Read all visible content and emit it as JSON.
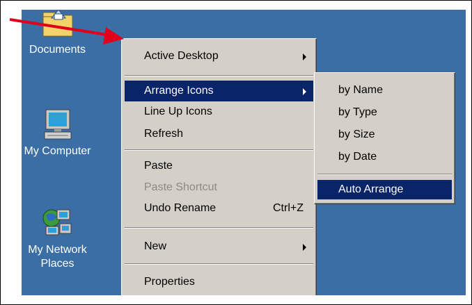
{
  "desktop": {
    "icons": [
      {
        "label": "Documents",
        "icon": "folder-icon"
      },
      {
        "label": "My Computer",
        "icon": "computer-icon"
      },
      {
        "label": "My Network Places",
        "icon": "network-icon"
      }
    ]
  },
  "context_menu": {
    "items": [
      {
        "label": "Active Desktop",
        "submenu": true
      },
      {
        "label": "Arrange Icons",
        "submenu": true,
        "selected": true
      },
      {
        "label": "Line Up Icons"
      },
      {
        "label": "Refresh"
      },
      {
        "label": "Paste"
      },
      {
        "label": "Paste Shortcut",
        "disabled": true
      },
      {
        "label": "Undo Rename",
        "shortcut": "Ctrl+Z"
      },
      {
        "label": "New",
        "submenu": true
      },
      {
        "label": "Properties"
      }
    ]
  },
  "arrange_submenu": {
    "items": [
      {
        "label": "by Name"
      },
      {
        "label": "by Type"
      },
      {
        "label": "by Size"
      },
      {
        "label": "by Date"
      },
      {
        "label": "Auto Arrange",
        "selected": true
      }
    ]
  },
  "colors": {
    "desktop": "#3a6ea5",
    "menu_bg": "#d4d0c8",
    "highlight": "#0a246a",
    "annotation_arrow": "#e0001b"
  }
}
